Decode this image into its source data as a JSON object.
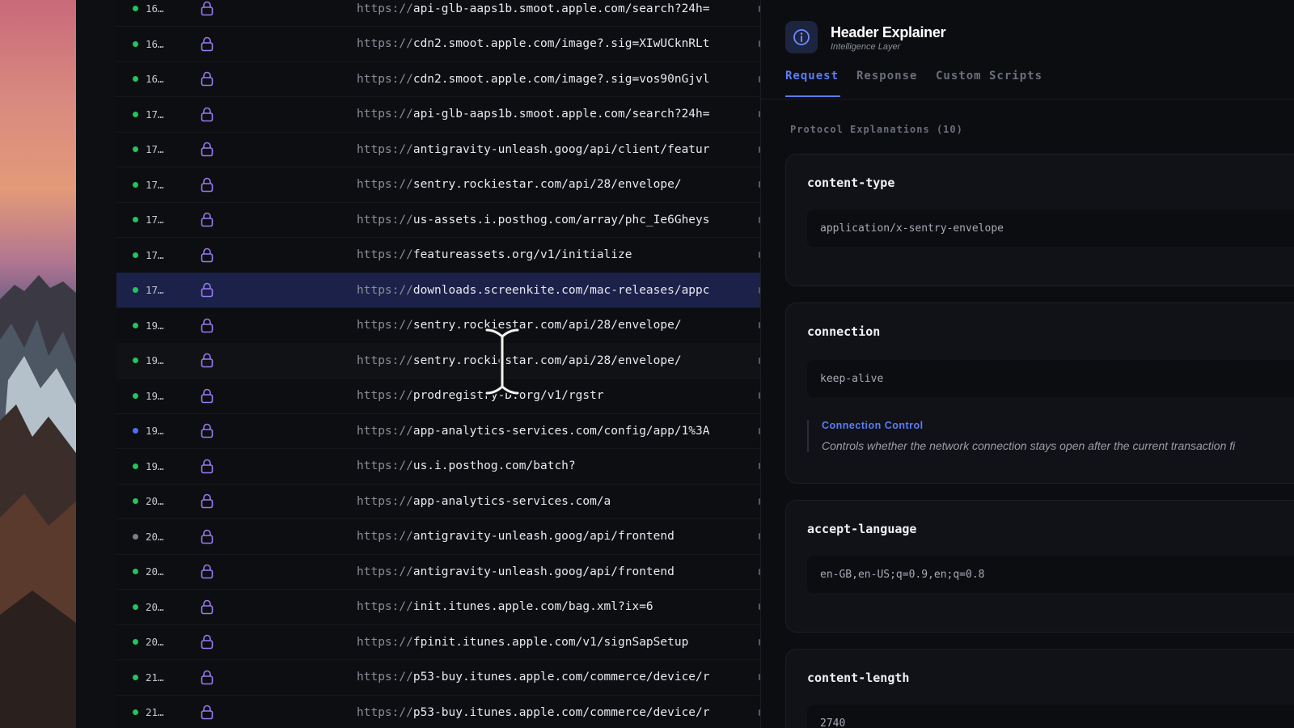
{
  "colors": {
    "status_green": "#22c55e",
    "status_blue": "#4f6ef7",
    "status_gray": "#7c808a",
    "accent": "#5b7cf6",
    "selected_row": "#1b2149"
  },
  "requests": [
    {
      "status": "green",
      "time": "16…",
      "scheme": "https://",
      "host": "api-glb-aaps1b.smoot.apple.com/search?24h="
    },
    {
      "status": "green",
      "time": "16…",
      "scheme": "https://",
      "host": "cdn2.smoot.apple.com/image?.sig=XIwUCknRLt"
    },
    {
      "status": "green",
      "time": "16…",
      "scheme": "https://",
      "host": "cdn2.smoot.apple.com/image?.sig=vos90nGjvl"
    },
    {
      "status": "green",
      "time": "17…",
      "scheme": "https://",
      "host": "api-glb-aaps1b.smoot.apple.com/search?24h="
    },
    {
      "status": "green",
      "time": "17…",
      "scheme": "https://",
      "host": "antigravity-unleash.goog/api/client/featur"
    },
    {
      "status": "green",
      "time": "17…",
      "scheme": "https://",
      "host": "sentry.rockiestar.com/api/28/envelope/"
    },
    {
      "status": "green",
      "time": "17…",
      "scheme": "https://",
      "host": "us-assets.i.posthog.com/array/phc_Ie6Gheys"
    },
    {
      "status": "green",
      "time": "17…",
      "scheme": "https://",
      "host": "featureassets.org/v1/initialize"
    },
    {
      "status": "green",
      "time": "17…",
      "scheme": "https://",
      "host": "downloads.screenkite.com/mac-releases/appc",
      "selected": true
    },
    {
      "status": "green",
      "time": "19…",
      "scheme": "https://",
      "host": "sentry.rockiestar.com/api/28/envelope/"
    },
    {
      "status": "green",
      "time": "19…",
      "scheme": "https://",
      "host": "sentry.rockiestar.com/api/28/envelope/",
      "hover": true
    },
    {
      "status": "green",
      "time": "19…",
      "scheme": "https://",
      "host": "prodregistry-D.org/v1/rgstr"
    },
    {
      "status": "blue",
      "time": "19…",
      "scheme": "https://",
      "host": "app-analytics-services.com/config/app/1%3A"
    },
    {
      "status": "green",
      "time": "19…",
      "scheme": "https://",
      "host": "us.i.posthog.com/batch?"
    },
    {
      "status": "green",
      "time": "20…",
      "scheme": "https://",
      "host": "app-analytics-services.com/a"
    },
    {
      "status": "gray",
      "time": "20…",
      "scheme": "https://",
      "host": "antigravity-unleash.goog/api/frontend"
    },
    {
      "status": "green",
      "time": "20…",
      "scheme": "https://",
      "host": "antigravity-unleash.goog/api/frontend"
    },
    {
      "status": "green",
      "time": "20…",
      "scheme": "https://",
      "host": "init.itunes.apple.com/bag.xml?ix=6"
    },
    {
      "status": "green",
      "time": "20…",
      "scheme": "https://",
      "host": "fpinit.itunes.apple.com/v1/signSapSetup"
    },
    {
      "status": "green",
      "time": "21…",
      "scheme": "https://",
      "host": "p53-buy.itunes.apple.com/commerce/device/r"
    },
    {
      "status": "green",
      "time": "21…",
      "scheme": "https://",
      "host": "p53-buy.itunes.apple.com/commerce/device/r"
    }
  ],
  "panel": {
    "title": "Header Explainer",
    "subtitle": "Intelligence Layer",
    "tabs": [
      "Request",
      "Response",
      "Custom Scripts"
    ],
    "active_tab": "Request",
    "section_label": "Protocol Explanations (10)",
    "headers": [
      {
        "name": "content-type",
        "value": "application/x-sentry-envelope"
      },
      {
        "name": "connection",
        "value": "keep-alive",
        "explanation_title": "Connection Control",
        "explanation": "Controls whether the network connection stays open after the current transaction fi"
      },
      {
        "name": "accept-language",
        "value": "en-GB,en-US;q=0.9,en;q=0.8"
      },
      {
        "name": "content-length",
        "value": "2740"
      }
    ]
  }
}
